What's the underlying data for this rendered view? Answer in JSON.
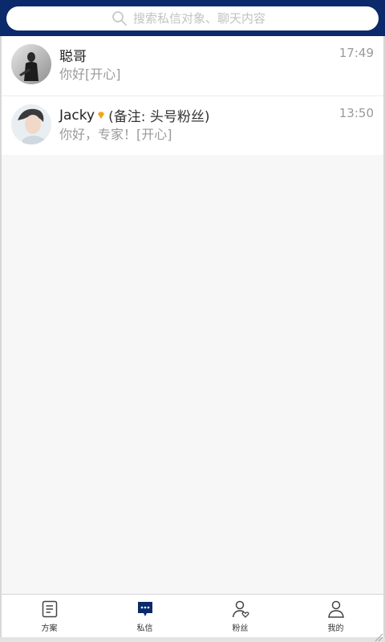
{
  "search": {
    "placeholder": "搜索私信对象、聊天内容"
  },
  "conversations": [
    {
      "name": "聪哥",
      "remark": "",
      "time": "17:49",
      "preview": "你好[开心]"
    },
    {
      "name": "Jacky",
      "remark": "(备注: 头号粉丝)",
      "time": "13:50",
      "preview": "你好，专家！[开心]"
    }
  ],
  "nav": [
    {
      "label": "方案",
      "icon": "document-list-icon"
    },
    {
      "label": "私信",
      "icon": "chat-bubble-icon",
      "active": true
    },
    {
      "label": "粉丝",
      "icon": "user-heart-icon"
    },
    {
      "label": "我的",
      "icon": "user-icon"
    }
  ],
  "colors": {
    "header": "#0b2a6b",
    "active": "#0b2a6b",
    "badge": "#f2a51a"
  }
}
